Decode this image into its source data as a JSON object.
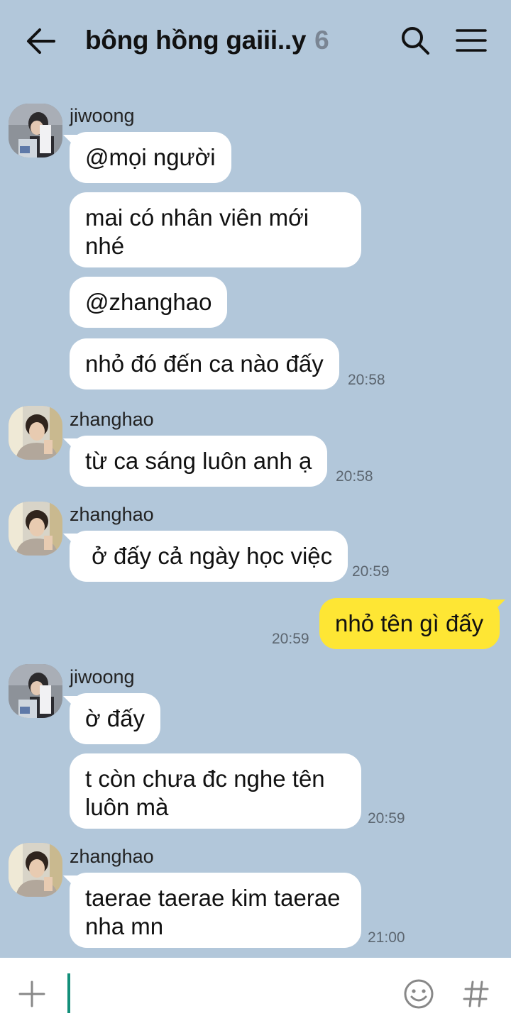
{
  "header": {
    "back_icon": "arrow-left-icon",
    "title": "bông hồng gaiii..y",
    "member_count": "6",
    "search_icon": "search-icon",
    "menu_icon": "hamburger-menu-icon"
  },
  "messages": [
    {
      "sender": "jiwoong",
      "avatar": "jiwoong-avatar",
      "texts": [
        "@mọi người",
        "mai có nhân viên mới\nnhé",
        "@zhanghao",
        "nhỏ đó đến ca nào đấy"
      ],
      "time": "20:58"
    },
    {
      "sender": "zhanghao",
      "avatar": "zhanghao-avatar",
      "texts": [
        "từ ca sáng luôn anh ạ"
      ],
      "time": "20:58"
    },
    {
      "sender": "zhanghao",
      "avatar": "zhanghao-avatar",
      "texts": [
        " ở đấy cả ngày học việc"
      ],
      "time": "20:59"
    },
    {
      "sender": "me",
      "texts": [
        "nhỏ tên gì đấy"
      ],
      "time": "20:59"
    },
    {
      "sender": "jiwoong",
      "avatar": "jiwoong-avatar",
      "texts": [
        "ờ đấy",
        "t còn chưa đc nghe tên\nluôn mà"
      ],
      "time": "20:59"
    },
    {
      "sender": "zhanghao",
      "avatar": "zhanghao-avatar",
      "texts": [
        "taerae taerae kim taerae\nnha mn"
      ],
      "time": "21:00"
    }
  ],
  "input": {
    "value": "",
    "add_icon": "plus-icon",
    "emoji_icon": "smiley-icon",
    "hashtag_icon": "hash-icon"
  },
  "colors": {
    "background": "#b2c7da",
    "my_bubble": "#fee634",
    "their_bubble": "#ffffff",
    "cursor": "#138f7a"
  }
}
